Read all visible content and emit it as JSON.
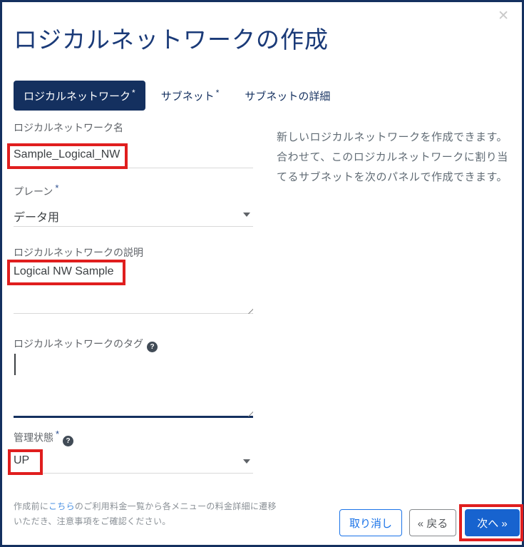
{
  "required_mark": "*",
  "help_glyph": "?",
  "dialog": {
    "title": "ロジカルネットワークの作成",
    "close_glyph": "✕"
  },
  "tabs": [
    {
      "label": "ロジカルネットワーク",
      "required": "*"
    },
    {
      "label": "サブネット",
      "required": "*"
    },
    {
      "label": "サブネットの詳細",
      "required": ""
    }
  ],
  "form": {
    "name": {
      "label": "ロジカルネットワーク名",
      "value": "Sample_Logical_NW"
    },
    "plane": {
      "label": "プレーン",
      "value": "データ用"
    },
    "description": {
      "label": "ロジカルネットワークの説明",
      "value": "Logical NW Sample"
    },
    "tags": {
      "label": "ロジカルネットワークのタグ",
      "value": ""
    },
    "admin_state": {
      "label": "管理状態",
      "value": "UP"
    }
  },
  "side_note": "新しいロジカルネットワークを作成できます。合わせて、このロジカルネットワークに割り当てるサブネットを次のパネルで作成できます。",
  "footer": {
    "note_before_link": "作成前に",
    "link_text": "こちら",
    "note_after_link": "のご利用料金一覧から各メニューの料金詳細に遷移いただき、注意事項をご確認ください。",
    "buttons": {
      "cancel": "取り消し",
      "back": "« 戻る",
      "next": "次へ »"
    }
  },
  "colors": {
    "navy": "#14305f",
    "title_navy": "#1a3a78",
    "primary_blue": "#1763cf",
    "outline_blue": "#1a73e8",
    "annotation_red": "#e01e1e",
    "link_blue": "#4a90e2"
  }
}
